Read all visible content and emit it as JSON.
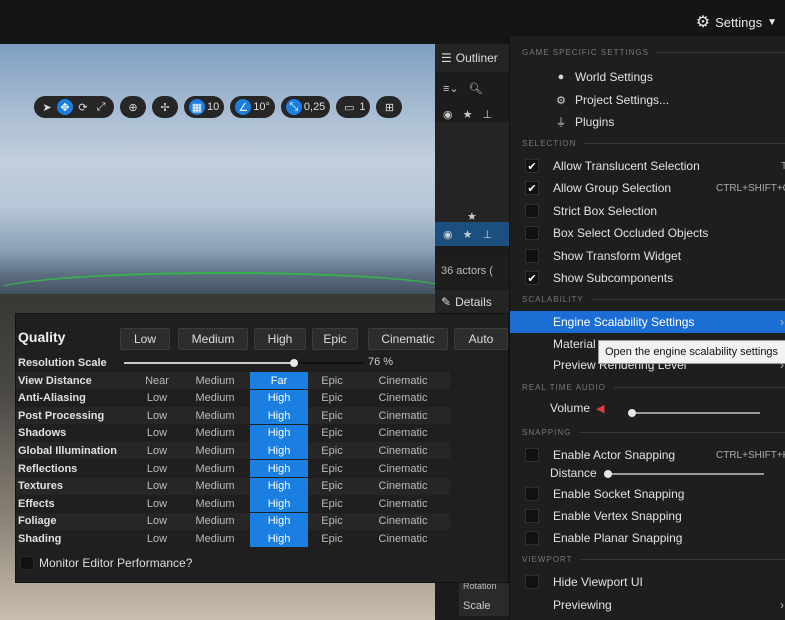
{
  "topbar": {
    "settings_label": "Settings"
  },
  "viewport_toolbar": {
    "grid_snap_value": "10",
    "rotation_snap_value": "10°",
    "scale_snap_value": "0,25",
    "camera_speed_value": "1"
  },
  "outliner": {
    "title": "Outliner",
    "actor_count": "36 actors (",
    "details_tab": "Details",
    "rotation_label": "Rotation",
    "scale_label": "Scale"
  },
  "scalability": {
    "title": "Quality",
    "presets": [
      "Low",
      "Medium",
      "High",
      "Epic",
      "Cinematic",
      "Auto"
    ],
    "resolution_label": "Resolution Scale",
    "resolution_value": "76 %",
    "resolution_fraction": 0.76,
    "rows": [
      {
        "label": "View Distance",
        "options": [
          "Near",
          "Medium",
          "Far",
          "Epic",
          "Cinematic"
        ],
        "selected": 2
      },
      {
        "label": "Anti-Aliasing",
        "options": [
          "Low",
          "Medium",
          "High",
          "Epic",
          "Cinematic"
        ],
        "selected": 2
      },
      {
        "label": "Post Processing",
        "options": [
          "Low",
          "Medium",
          "High",
          "Epic",
          "Cinematic"
        ],
        "selected": 2
      },
      {
        "label": "Shadows",
        "options": [
          "Low",
          "Medium",
          "High",
          "Epic",
          "Cinematic"
        ],
        "selected": 2
      },
      {
        "label": "Global Illumination",
        "options": [
          "Low",
          "Medium",
          "High",
          "Epic",
          "Cinematic"
        ],
        "selected": 2
      },
      {
        "label": "Reflections",
        "options": [
          "Low",
          "Medium",
          "High",
          "Epic",
          "Cinematic"
        ],
        "selected": 2
      },
      {
        "label": "Textures",
        "options": [
          "Low",
          "Medium",
          "High",
          "Epic",
          "Cinematic"
        ],
        "selected": 2
      },
      {
        "label": "Effects",
        "options": [
          "Low",
          "Medium",
          "High",
          "Epic",
          "Cinematic"
        ],
        "selected": 2
      },
      {
        "label": "Foliage",
        "options": [
          "Low",
          "Medium",
          "High",
          "Epic",
          "Cinematic"
        ],
        "selected": 2
      },
      {
        "label": "Shading",
        "options": [
          "Low",
          "Medium",
          "High",
          "Epic",
          "Cinematic"
        ],
        "selected": 2
      }
    ],
    "monitor_label": "Monitor Editor Performance?"
  },
  "settings_menu": {
    "sections": {
      "game": "GAME SPECIFIC SETTINGS",
      "selection": "SELECTION",
      "scalability": "SCALABILITY",
      "audio": "REAL TIME AUDIO",
      "snapping": "SNAPPING",
      "viewport": "VIEWPORT"
    },
    "world_settings": "World Settings",
    "project_settings": "Project Settings...",
    "plugins": "Plugins",
    "allow_translucent": "Allow Translucent Selection",
    "allow_translucent_shortcut": "T",
    "allow_group": "Allow Group Selection",
    "allow_group_shortcut": "CTRL+SHIFT+G",
    "strict_box": "Strict Box Selection",
    "box_occluded": "Box Select Occluded Objects",
    "show_transform": "Show Transform Widget",
    "show_subcomponents": "Show Subcomponents",
    "engine_scalability": "Engine Scalability Settings",
    "material": "Material",
    "preview_rendering": "Preview Rendering Level",
    "volume_label": "Volume",
    "volume_fraction": 0.0,
    "enable_actor_snapping": "Enable Actor Snapping",
    "actor_snapping_shortcut": "CTRL+SHIFT+K",
    "distance_label": "Distance",
    "enable_socket_snapping": "Enable Socket Snapping",
    "enable_vertex_snapping": "Enable Vertex Snapping",
    "enable_planar_snapping": "Enable Planar Snapping",
    "hide_viewport_ui": "Hide Viewport UI",
    "previewing": "Previewing",
    "tooltip": "Open the engine scalability settings"
  },
  "colors": {
    "accent": "#1a7fe0",
    "menu_highlight": "#1b6fd4",
    "panel": "#1f1f1f"
  }
}
